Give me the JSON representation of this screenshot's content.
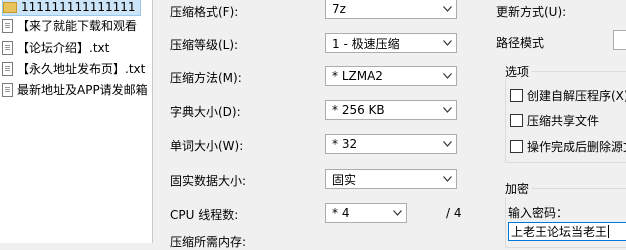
{
  "file_list": {
    "items": [
      {
        "name": "111111111111111",
        "type": "folder",
        "selected": true
      },
      {
        "name": "【来了就能下载和观看",
        "type": "file"
      },
      {
        "name": "【论坛介绍】.txt",
        "type": "file"
      },
      {
        "name": "【永久地址发布页】.txt",
        "type": "file"
      },
      {
        "name": "最新地址及APP请发邮箱",
        "type": "file"
      }
    ]
  },
  "options": {
    "format": {
      "label": "压缩格式(F):",
      "value": "7z"
    },
    "level": {
      "label": "压缩等级(L):",
      "value": "1 - 极速压缩"
    },
    "method": {
      "label": "压缩方法(M):",
      "value": "* LZMA2"
    },
    "dict_size": {
      "label": "字典大小(D):",
      "value": "* 256 KB"
    },
    "word_size": {
      "label": "单词大小(W):",
      "value": "* 32"
    },
    "solid_size": {
      "label": "固实数据大小:",
      "value": "固实"
    },
    "threads": {
      "label": "CPU 线程数:",
      "value": "* 4",
      "total": "/ 4"
    },
    "memory": {
      "label": "压缩所需内存:"
    }
  },
  "right_panel": {
    "update_mode_label": "更新方式(U):",
    "path_mode_label": "路径模式",
    "options_group": {
      "title": "选项",
      "checkboxes": [
        {
          "label": "创建自解压程序(X)",
          "checked": false
        },
        {
          "label": "压缩共享文件",
          "checked": false
        },
        {
          "label": "操作完成后删除源文件",
          "checked": false
        }
      ]
    },
    "encryption_group": {
      "title": "加密",
      "password_label": "输入密码：",
      "password_value": "上老王论坛当老王"
    }
  }
}
